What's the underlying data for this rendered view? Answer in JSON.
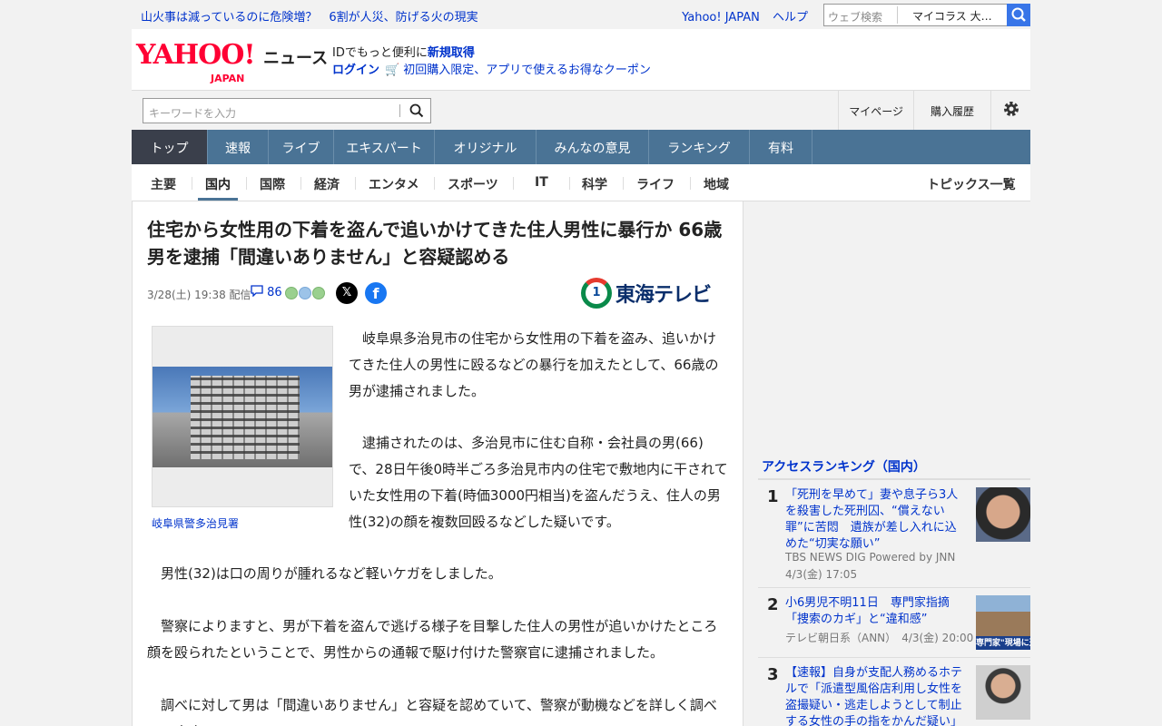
{
  "topbar": {
    "headline": "山火事は減っているのに危険増？　6割が人災、防げる火の現実",
    "yahoo_japan": "Yahoo! JAPAN",
    "help": "ヘルプ",
    "web_search_placeholder": "ウェブ検索",
    "web_search_scope": "マイコラス 大…"
  },
  "header": {
    "logo_text": "YAHOO!",
    "logo_sub": "JAPAN",
    "service": "ニュース",
    "promo_prefix": "IDでもっと便利に",
    "promo_register": "新規取得",
    "login": "ログイン",
    "coupon": "初回購入限定、アプリで使えるお得なクーポン"
  },
  "search": {
    "placeholder": "キーワードを入力",
    "mypage": "マイページ",
    "purchase_history": "購入履歴"
  },
  "mainnav": [
    "トップ",
    "速報",
    "ライブ",
    "エキスパート",
    "オリジナル",
    "みんなの意見",
    "ランキング",
    "有料"
  ],
  "subnav": [
    "主要",
    "国内",
    "国際",
    "経済",
    "エンタメ",
    "スポーツ",
    "IT",
    "科学",
    "ライフ",
    "地域"
  ],
  "subnav_right": "トピックス一覧",
  "article": {
    "title": "住宅から女性用の下着を盗んで追いかけてきた住人男性に暴行か 66歳男を逮捕「間違いありません」と容疑認める",
    "date": "3/28(土) 19:38",
    "distributed": "配信",
    "comment_count": "86",
    "provider": "東海テレビ",
    "provider_number": "1",
    "photo_caption": "岐阜県警多治見署",
    "p1": "岐阜県多治見市の住宅から女性用の下着を盗み、追いかけてきた住人の男性に殴るなどの暴行を加えたとして、66歳の男が逮捕されました。",
    "p2": "逮捕されたのは、多治見市に住む自称・会社員の男(66)で、28日午後0時半ごろ多治見市内の住宅で敷地内に干されていた女性用の下着(時価3000円相当)を盗んだうえ、住人の男性(32)の顔を複数回殴るなどした疑いです。",
    "p3": "男性(32)は口の周りが腫れるなど軽いケガをしました。",
    "p4": "警察によりますと、男が下着を盗んで逃げる様子を目撃した住人の男性が追いかけたところ顔を殴られたということで、男性からの通報で駆け付けた警察官に逮捕されました。",
    "p5": "調べに対して男は「間違いありません」と容疑を認めていて、警察が動機などを詳しく調べています。"
  },
  "ranking": {
    "title": "アクセスランキング（国内）",
    "items": [
      {
        "rank": "1",
        "title": "「死刑を早めて」妻や息子ら3人を殺害した死刑囚、“償えない罪”に苦悶　遺族が差し入れに込めた“切実な願い”",
        "source": "TBS NEWS DIG Powered by JNN",
        "time": "4/3(金) 17:05"
      },
      {
        "rank": "2",
        "title": "小6男児不明11日　専門家指摘「捜索のカギ」と“違和感”",
        "source": "テレビ朝日系（ANN）",
        "time": "4/3(金) 20:00",
        "thumb_text": "専門家\"現場に違"
      },
      {
        "rank": "3",
        "title": "【速報】自身が支配人務めるホテルで「派遣型風俗店利用し女性を盗撮疑い・逃走しようとして制止する女性の手の指をかんだ疑い」",
        "source": "",
        "time": ""
      }
    ]
  }
}
